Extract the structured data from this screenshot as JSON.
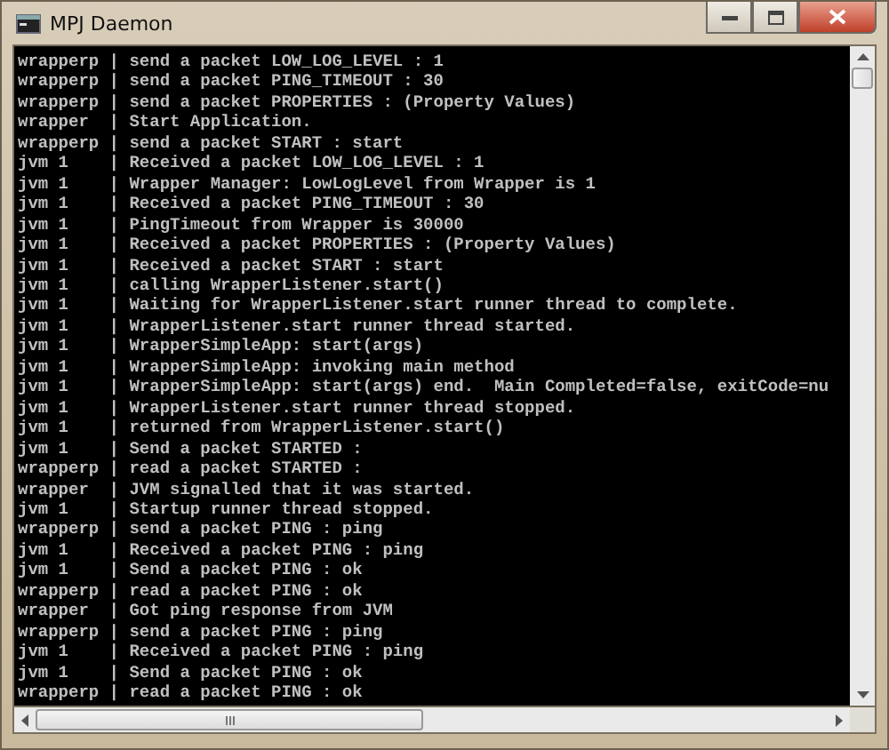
{
  "window": {
    "title": "MPJ Daemon"
  },
  "console": {
    "lines": [
      "wrapperp | send a packet LOW_LOG_LEVEL : 1",
      "wrapperp | send a packet PING_TIMEOUT : 30",
      "wrapperp | send a packet PROPERTIES : (Property Values)",
      "wrapper  | Start Application.",
      "wrapperp | send a packet START : start",
      "jvm 1    | Received a packet LOW_LOG_LEVEL : 1",
      "jvm 1    | Wrapper Manager: LowLogLevel from Wrapper is 1",
      "jvm 1    | Received a packet PING_TIMEOUT : 30",
      "jvm 1    | PingTimeout from Wrapper is 30000",
      "jvm 1    | Received a packet PROPERTIES : (Property Values)",
      "jvm 1    | Received a packet START : start",
      "jvm 1    | calling WrapperListener.start()",
      "jvm 1    | Waiting for WrapperListener.start runner thread to complete.",
      "jvm 1    | WrapperListener.start runner thread started.",
      "jvm 1    | WrapperSimpleApp: start(args)",
      "jvm 1    | WrapperSimpleApp: invoking main method",
      "jvm 1    | WrapperSimpleApp: start(args) end.  Main Completed=false, exitCode=nu",
      "jvm 1    | WrapperListener.start runner thread stopped.",
      "jvm 1    | returned from WrapperListener.start()",
      "jvm 1    | Send a packet STARTED :",
      "wrapperp | read a packet STARTED :",
      "wrapper  | JVM signalled that it was started.",
      "jvm 1    | Startup runner thread stopped.",
      "wrapperp | send a packet PING : ping",
      "jvm 1    | Received a packet PING : ping",
      "jvm 1    | Send a packet PING : ok",
      "wrapperp | read a packet PING : ok",
      "wrapper  | Got ping response from JVM",
      "wrapperp | send a packet PING : ping",
      "jvm 1    | Received a packet PING : ping",
      "jvm 1    | Send a packet PING : ok",
      "wrapperp | read a packet PING : ok"
    ]
  }
}
